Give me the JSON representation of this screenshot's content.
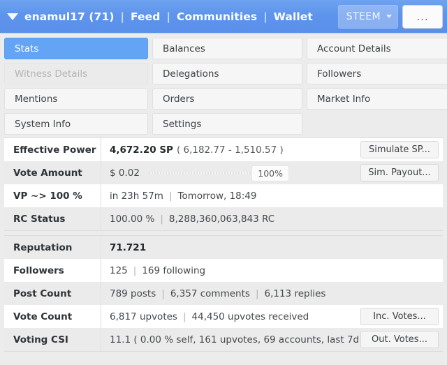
{
  "navbar": {
    "caret_icon": "caret-down-icon",
    "username": "enamul17 (71)",
    "separator": "|",
    "links": [
      {
        "label": "Feed"
      },
      {
        "label": "Communities"
      },
      {
        "label": "Wallet"
      }
    ],
    "token_selector": {
      "label": "STEEM",
      "chevron_icon": "chevron-down-icon"
    },
    "more_button": {
      "label": "..."
    },
    "background_color": "#5e94ec"
  },
  "tabs": [
    {
      "label": "Stats",
      "state": "active"
    },
    {
      "label": "Balances",
      "state": "normal"
    },
    {
      "label": "Account Details",
      "state": "normal"
    },
    {
      "label": "Witness Details",
      "state": "disabled"
    },
    {
      "label": "Delegations",
      "state": "normal"
    },
    {
      "label": "Followers",
      "state": "normal"
    },
    {
      "label": "Mentions",
      "state": "normal"
    },
    {
      "label": "Orders",
      "state": "normal"
    },
    {
      "label": "Market Info",
      "state": "normal"
    },
    {
      "label": "System Info",
      "state": "normal"
    },
    {
      "label": "Settings",
      "state": "normal"
    },
    {
      "label": "",
      "state": "empty"
    }
  ],
  "stats_primary": {
    "effective_power": {
      "label": "Effective Power",
      "value_strong": "4,672.20 SP",
      "value_detail": "( 6,182.77 - 1,510.57 )",
      "action": "Simulate SP..."
    },
    "vote_amount": {
      "label": "Vote Amount",
      "amount": "$ 0.02",
      "percent": "100%",
      "percent_value": 100,
      "action": "Sim. Payout..."
    },
    "vp_to_full": {
      "label": "VP ~> 100 %",
      "value_a": "in 23h 57m",
      "separator": "|",
      "value_b": "Tomorrow, 18:49"
    },
    "rc_status": {
      "label": "RC Status",
      "value_a": "100.00 %",
      "separator": "|",
      "value_b": "8,288,360,063,843 RC"
    }
  },
  "stats_secondary": {
    "reputation": {
      "label": "Reputation",
      "value": "71.721"
    },
    "followers": {
      "label": "Followers",
      "value_a": "125",
      "separator": "|",
      "value_b": "169 following"
    },
    "post_count": {
      "label": "Post Count",
      "value_a": "789 posts",
      "separator_1": "|",
      "value_b": "6,357 comments",
      "separator_2": "|",
      "value_c": "6,113 replies"
    },
    "vote_count": {
      "label": "Vote Count",
      "value_a": "6,817 upvotes",
      "separator": "|",
      "value_b": "44,450 upvotes received",
      "action": "Inc. Votes..."
    },
    "voting_csi": {
      "label": "Voting CSI",
      "value": "11.1 ( 0.00 % self, 161 upvotes, 69 accounts, last 7d )",
      "action": "Out. Votes..."
    }
  }
}
